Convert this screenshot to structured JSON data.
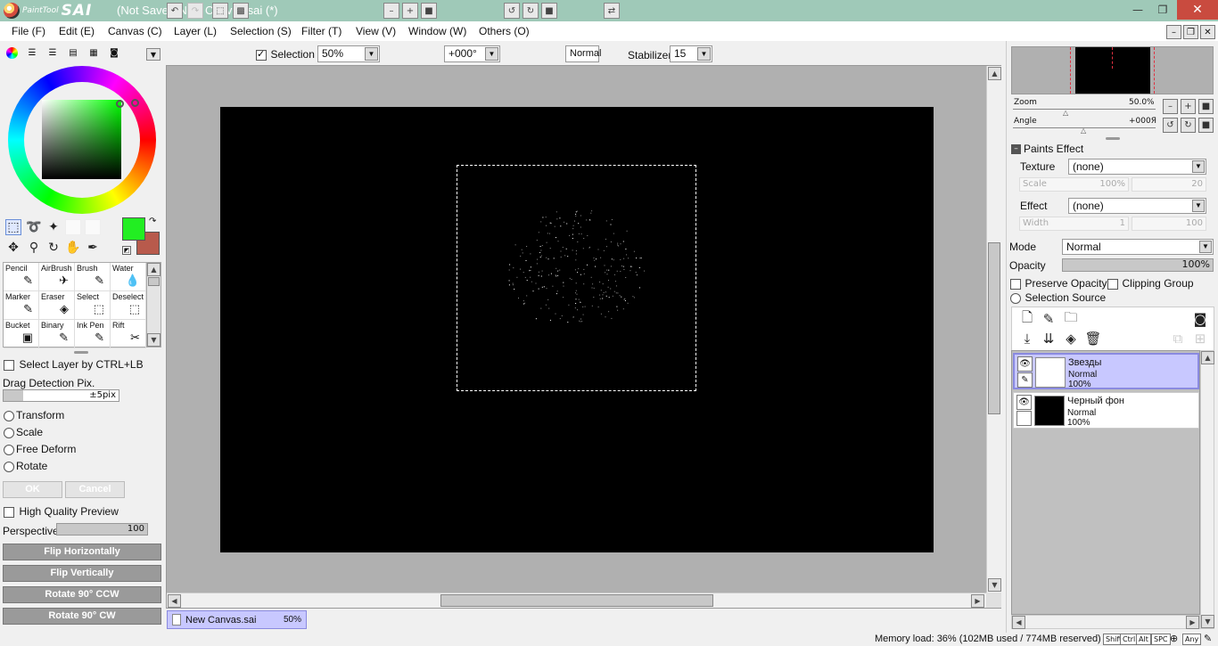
{
  "titlebar": {
    "logo_small": "PaintTool",
    "logo_big": "SAI",
    "title": "(Not Saved)New Canvas.sai (*)"
  },
  "menu": [
    "File (F)",
    "Edit (E)",
    "Canvas (C)",
    "Layer (L)",
    "Selection (S)",
    "Filter (T)",
    "View (V)",
    "Window (W)",
    "Others (O)"
  ],
  "toolbar": {
    "selection_label": "Selection",
    "zoom_value": "50%",
    "angle_value": "+000°",
    "blend_mode": "Normal",
    "stabilizer_label": "Stabilizer",
    "stabilizer_value": "15"
  },
  "tools": [
    {
      "label": "Pencil",
      "icon": "✎"
    },
    {
      "label": "AirBrush",
      "icon": "✈"
    },
    {
      "label": "Brush",
      "icon": "✎"
    },
    {
      "label": "Water",
      "icon": "💧"
    },
    {
      "label": "Marker",
      "icon": "✎"
    },
    {
      "label": "Eraser",
      "icon": "◈"
    },
    {
      "label": "Select",
      "icon": "⬚"
    },
    {
      "label": "Deselect",
      "icon": "⬚"
    },
    {
      "label": "Bucket",
      "icon": "▣"
    },
    {
      "label": "Binary",
      "icon": "✎"
    },
    {
      "label": "Ink Pen",
      "icon": "✎"
    },
    {
      "label": "Rift",
      "icon": "✂"
    }
  ],
  "left": {
    "select_layer_label": "Select Layer by CTRL+LB",
    "drag_detection_label": "Drag Detection Pix.",
    "drag_detection_value": "±5pix",
    "transform_options": [
      "Transform",
      "Scale",
      "Free Deform",
      "Rotate"
    ],
    "ok_label": "OK",
    "cancel_label": "Cancel",
    "hq_preview_label": "High Quality Preview",
    "perspective_label": "Perspective",
    "perspective_value": "100",
    "flip_h_label": "Flip Horizontally",
    "flip_v_label": "Flip Vertically",
    "rotate_ccw_label": "Rotate 90° CCW",
    "rotate_cw_label": "Rotate 90° CW",
    "primary_color": "#22ee22",
    "secondary_color": "#b85a4c"
  },
  "navigator": {
    "zoom_label": "Zoom",
    "zoom_value": "50.0%",
    "angle_label": "Angle",
    "angle_value": "+000Я"
  },
  "paints_effect": {
    "title": "Paints Effect",
    "texture_label": "Texture",
    "texture_value": "(none)",
    "scale_label": "Scale",
    "scale_value": "100%",
    "scale_num": "20",
    "effect_label": "Effect",
    "effect_value": "(none)",
    "width_label": "Width",
    "width_value": "1",
    "width_num": "100"
  },
  "layer_props": {
    "mode_label": "Mode",
    "mode_value": "Normal",
    "opacity_label": "Opacity",
    "opacity_value": "100%",
    "preserve_label": "Preserve Opacity",
    "clipping_label": "Clipping Group",
    "selection_source_label": "Selection Source"
  },
  "layers": [
    {
      "name": "Звезды",
      "mode": "Normal",
      "opacity": "100%",
      "thumb": "#ffffff",
      "selected": true
    },
    {
      "name": "Черный фон",
      "mode": "Normal",
      "opacity": "100%",
      "thumb": "#000000",
      "selected": false
    }
  ],
  "doc_tab": {
    "name": "New Canvas.sai",
    "zoom": "50%"
  },
  "status": {
    "memory": "Memory load: 36% (102MB used / 774MB reserved)",
    "keys": [
      "Shift",
      "Ctrl",
      "Alt",
      "SPC",
      "Any"
    ]
  }
}
